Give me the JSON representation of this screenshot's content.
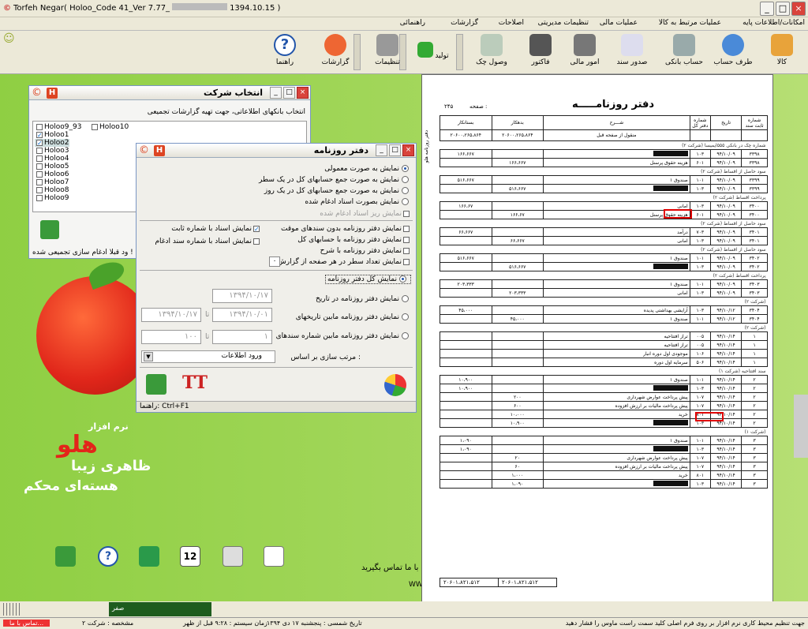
{
  "app": {
    "title": "Torfeh Negar( Holoo_Code 41_Ver 7.77_",
    "title_suffix": "1394.10.15 )",
    "icon": "app-logo-icon"
  },
  "menu": [
    "امکانات/اطلاعات پایه",
    "عملیات مرتبط به کالا",
    "عملیات مالی",
    "تنظیمات مدیریتی",
    "اصلاحات",
    "گزارشات",
    "راهنمائی"
  ],
  "toolbar": [
    "کالا",
    "طرف حساب",
    "حساب بانکی",
    "صدور سند",
    "امور مالی",
    "فاکتور",
    "وصول چک",
    "تولید",
    "تنظیمات",
    "گزارشات",
    "راهنما"
  ],
  "company_window": {
    "title": "انتخاب شرکت",
    "subtitle": "انتخاب بانکهای اطلاعاتی، جهت تهیه گزارشات تجمیعی",
    "items": [
      "Holoo9_93",
      "Holoo10",
      "Holoo1",
      "Holoo2",
      "Holoo3",
      "Holoo4",
      "Holoo5",
      "Holoo6",
      "Holoo7",
      "Holoo8",
      "Holoo9"
    ],
    "footer": "ود قبلا ادغام سازی تجمیعی شده !"
  },
  "journal_window": {
    "title": "دفتر روزنامه",
    "options": [
      "نمایش به صورت معمولی",
      "نمایش به صورت جمع حسابهای کل در یک سطر",
      "نمایش به صورت جمع حسابهای کل در یک روز",
      "نمایش بصورت اسناد ادغام شده",
      "نمایش ریز اسناد ادغام شده"
    ],
    "checks_right": [
      "نمایش دفتر روزنامه بدون سندهای موقت",
      "نمایش دفتر روزنامه با حسابهای کل",
      "نمایش دفتر روزنامه با شرح",
      "نمایش تعداد سطر در هر صفحه از گزارش"
    ],
    "checks_left": [
      "نمایش اسناد با شماره ثابت",
      "نمایش اسناد با شماره سند ادغام"
    ],
    "lines_value": "۰",
    "ranges": [
      "نمایش کل دفتر روزنامه",
      "نمایش دفتر روزنامه در تاریخ",
      "نمایش دفتر روزنامه مابین تاریخهای",
      "نمایش دفتر روزنامه مابین شماره سندهای"
    ],
    "date1": "۱۳۹۴/۱۰/۱۷",
    "date_from": "۱۳۹۴/۱۰/۰۱",
    "date_to": "۱۳۹۴/۱۰/۱۷",
    "num_from": "۱",
    "num_to": "۱۰۰",
    "to_label": "تا",
    "sort_label": "مرتب سازی بر اساس :",
    "sort_value": "ورود اطلاعات",
    "hint": "راهنما: Ctrl+F1"
  },
  "report": {
    "title": "دفتر روزنامـــــه",
    "page_label": "صفحه :",
    "page_no": "۲۴۵",
    "side_label": "دفتر روزنامه هلو",
    "headers": [
      "شماره ثابت سند",
      "تاریخ",
      "شماره دفتر کل",
      "شـــرح",
      "بدهکار",
      "بستانکار"
    ],
    "carry_label": "منقول از صفحه قبل",
    "carry_debit": "۲۰۶۰۰،۲۶۵،۸۶۴",
    "carry_credit": "۲۰۶۰۰،۲۶۵،۸۶۴",
    "rows": [
      [
        "sec",
        "شماره چک در بانکی ۵۵۵ایمیسا",
        "(شرکت ۲)"
      ],
      [
        "r",
        "۳۳۹۸",
        "۹۴/۱۰/۰۹",
        "۱۰۳",
        "BLK",
        "",
        "۱۶۶،۶۶۷"
      ],
      [
        "r",
        "۳۳۹۸",
        "۹۴/۱۰/۰۹",
        "۶۰۱",
        "هزینه حقوق پرسنل",
        "۱۶۶،۶۶۷",
        ""
      ],
      [
        "sec",
        "سود حاصل از اقساط",
        "(شرکت ۲)"
      ],
      [
        "r",
        "۳۳۹۹",
        "۹۴/۱۰/۰۹",
        "۱۰۱",
        "صندوق ۱",
        "",
        "۵۱۶،۶۶۷"
      ],
      [
        "r",
        "۳۳۹۹",
        "۹۴/۱۰/۰۹",
        "۱۰۳",
        "BLK",
        "۵۱۶،۶۶۷",
        ""
      ],
      [
        "sec",
        "پرداخت اقساط",
        "(شرکت ۲)"
      ],
      [
        "r",
        "۳۴۰۰",
        "۹۴/۱۰/۰۹",
        "۱۰۳",
        "امانی",
        "",
        "۱۶۶،۶۷"
      ],
      [
        "r",
        "۳۴۰۰",
        "۹۴/۱۰/۰۹",
        "۶۰۱",
        "هزینه حقوق پرسنل",
        "۱۶۶،۶۷",
        ""
      ],
      [
        "sec",
        "سود حاصل از اقساط",
        "(شرکت ۲)"
      ],
      [
        "r",
        "۳۴۰۱",
        "۹۴/۱۰/۰۹",
        "۷۰۳",
        "درآمد",
        "",
        "۶۶،۶۶۷"
      ],
      [
        "r",
        "۳۴۰۱",
        "۹۴/۱۰/۰۹",
        "۱۰۳",
        "امانی",
        "۶۶،۶۶۷",
        ""
      ],
      [
        "sec",
        "سود حاصل از اقساط",
        "(شرکت ۲)"
      ],
      [
        "r",
        "۳۴۰۲",
        "۹۴/۱۰/۰۹",
        "۱۰۱",
        "صندوق ۱",
        "",
        "۵۱۶،۶۶۷"
      ],
      [
        "r",
        "۳۴۰۲",
        "۹۴/۱۰/۰۹",
        "۱۰۳",
        "BLK",
        "۵۱۶،۶۶۷",
        ""
      ],
      [
        "sec",
        "پرداخت اقساط",
        "(شرکت ۲)"
      ],
      [
        "r",
        "۳۴۰۳",
        "۹۴/۱۰/۰۹",
        "۱۰۱",
        "صندوق ۱",
        "",
        "۲۰۳،۳۳۳"
      ],
      [
        "r",
        "۳۴۰۳",
        "۹۴/۱۰/۰۹",
        "۱۰۳",
        "امانی",
        "۲۰۳،۳۳۳",
        ""
      ],
      [
        "sec",
        "",
        "(شرکت ۲)"
      ],
      [
        "r",
        "۳۴۰۴",
        "۹۴/۱۰/۱۲",
        "۱۰۳",
        "آرایشی بهداشتی پدیده",
        "",
        "۴۵،۰۰۰"
      ],
      [
        "r",
        "۳۴۰۴",
        "۹۴/۱۰/۱۲",
        "۱۰۱",
        "صندوق ۱",
        "۴۵،۰۰۰",
        ""
      ],
      [
        "sec",
        "",
        "(شرکت ۲)"
      ],
      [
        "r",
        "۱",
        "۹۴/۱۰/۱۴",
        "۰۰۵",
        "تراز افتتاحیه",
        "",
        ""
      ],
      [
        "r",
        "۱",
        "۹۴/۱۰/۱۴",
        "۰۰۵",
        "تراز افتتاحیه",
        "",
        ""
      ],
      [
        "r",
        "۱",
        "۹۴/۱۰/۱۴",
        "۱۰۶",
        "موجودی اول دوره انبار",
        "",
        ""
      ],
      [
        "r",
        "۱",
        "۹۴/۱۰/۱۴",
        "۵۰۶",
        "سرمایه اول دوره",
        "",
        ""
      ],
      [
        "sec",
        "سند افتتاحیه",
        "(شرکت ۱)"
      ],
      [
        "r",
        "۲",
        "۹۴/۱۰/۱۴",
        "۱۰۱",
        "صندوق ۱",
        "",
        "۱۰،۹۰۰"
      ],
      [
        "r",
        "۲",
        "۹۴/۱۰/۱۴",
        "۱۰۳",
        "BLK",
        "",
        "۱۰،۹۰۰"
      ],
      [
        "r",
        "۲",
        "۹۴/۱۰/۱۴",
        "۱۰۷",
        "پیش پرداخت عوارض شهرداری",
        "۲۰۰",
        ""
      ],
      [
        "r",
        "۲",
        "۹۴/۱۰/۱۴",
        "۱۰۷",
        "پیش پرداخت مالیات بر ارزش افزوده",
        "۶۰۰",
        ""
      ],
      [
        "r",
        "۲",
        "۹۴/۱۰/۱۴",
        "۸۰۱",
        "خرید",
        "۱۰،۰۰۰",
        ""
      ],
      [
        "r",
        "۲",
        "۹۴/۱۰/۱۴",
        "۱۰۳",
        "BLK",
        "۱۰،۹۰۰",
        ""
      ],
      [
        "sec",
        "",
        "(شرکت ۱)"
      ],
      [
        "r",
        "۳",
        "۹۴/۱۰/۱۴",
        "۱۰۱",
        "صندوق ۱",
        "",
        "۱،۰۹۰"
      ],
      [
        "r",
        "۳",
        "۹۴/۱۰/۱۴",
        "۱۰۳",
        "BLK",
        "",
        "۱،۰۹۰"
      ],
      [
        "r",
        "۳",
        "۹۴/۱۰/۱۴",
        "۱۰۷",
        "پیش پرداخت عوارض شهرداری",
        "۲۰",
        ""
      ],
      [
        "r",
        "۳",
        "۹۴/۱۰/۱۴",
        "۱۰۷",
        "پیش پرداخت مالیات بر ارزش افزوده",
        "۶۰",
        ""
      ],
      [
        "r",
        "۳",
        "۹۴/۱۰/۱۴",
        "۸۰۱",
        "خرید",
        "۱،۰۰۰",
        ""
      ],
      [
        "r",
        "۳",
        "۹۴/۱۰/۱۴",
        "۱۰۳",
        "BLK",
        "۱،۰۹۰",
        ""
      ]
    ],
    "total_debit": "۲۰۶۰۱،۸۲۱،۵۱۲",
    "total_credit": "۲۰۶۰۱،۸۲۱،۵۱۲"
  },
  "brand": {
    "line1": "نرم افزار",
    "name": "هلو",
    "line2": "ظاهری زیبا",
    "line3": "هسته‌ای محکم",
    "contact": "با ما تماس بگیرید",
    "web": "WW"
  },
  "taskbar": {
    "item": "صفر"
  },
  "status": [
    "جهت تنظیم محیط کاری نرم افزار بر روی فرم اصلی کلید سمت راست ماوس را فشار دهید",
    "تاریخ شمسی : پنجشنبه ۱۷ دی ۱۳۹۴",
    "زمان سیستم : ۹:۲۸ قبل از ظهر",
    "مشخصه : شرکت ۲",
    "تماس با ما..."
  ],
  "colors": {
    "desktop": "#8fcf43",
    "highlight_box": "#e00000",
    "accent": "#2255aa"
  }
}
